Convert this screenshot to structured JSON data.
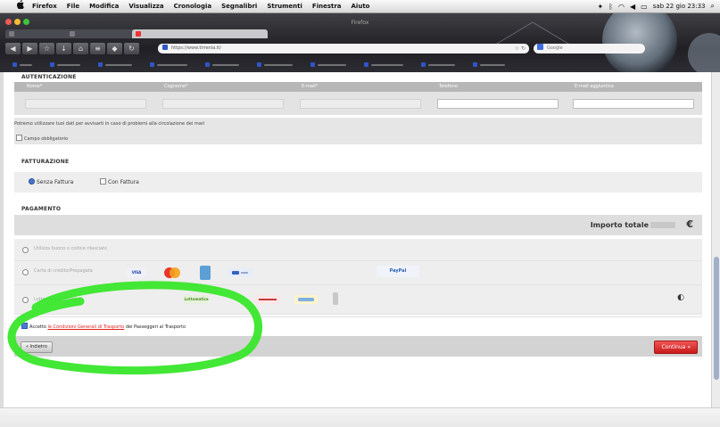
{
  "menubar": {
    "items": [
      "Firefox",
      "File",
      "Modifica",
      "Visualizza",
      "Cronologia",
      "Segnalibri",
      "Strumenti",
      "Finestra",
      "Aiuto"
    ],
    "clock": "sab 22 gio 23:33"
  },
  "browser": {
    "window_title": "Firefox",
    "tabs": [
      "",
      "",
      ""
    ],
    "url": "https://www.tirrenia.it/",
    "search_placeholder": "Google"
  },
  "page": {
    "auth_section": {
      "heading": "AUTENTICAZIONE",
      "columns": [
        "Nome*",
        "Cognome*",
        "E-mail*",
        "Telefono",
        "E-mail aggiuntiva"
      ],
      "fields": [
        {
          "placeholder": "",
          "enabled": false
        },
        {
          "placeholder": "",
          "enabled": false
        },
        {
          "placeholder": "",
          "enabled": false
        },
        {
          "placeholder": "",
          "enabled": true
        },
        {
          "placeholder": "",
          "enabled": true
        }
      ],
      "privacy_note": "Potremo utilizzare tuoi dati per avvisarti in caso di problemi alla circolazione dei mari",
      "privacy_checkbox": "Campo obbligatorio"
    },
    "billing_section": {
      "heading": "FATTURAZIONE",
      "options": [
        "Senza Fattura",
        "Con Fattura"
      ],
      "selected": 0
    },
    "payment_section": {
      "heading": "PAGAMENTO",
      "total_label": "Importo totale",
      "currency_symbol": "€",
      "methods": [
        {
          "label": "Utilizza buono o codice rilasciato"
        },
        {
          "label": "Carta di credito/Prepagata"
        },
        {
          "label": "Lottomatica/PayPal"
        }
      ],
      "logos": {
        "visa": "VISA",
        "paypal": "PayPal",
        "lottomatica": "Lottomatica"
      }
    },
    "terms": {
      "prefix": "Accetto",
      "link_text": "le Condizioni Generali di Trasporto",
      "suffix": "dei Passeggeri al Trasporto"
    },
    "actions": {
      "back": "« Indietro",
      "continue": "Continua »"
    }
  },
  "colors": {
    "continue_red": "#d62a2a",
    "link_red": "#d22222",
    "highlight_green": "#39e62a"
  }
}
